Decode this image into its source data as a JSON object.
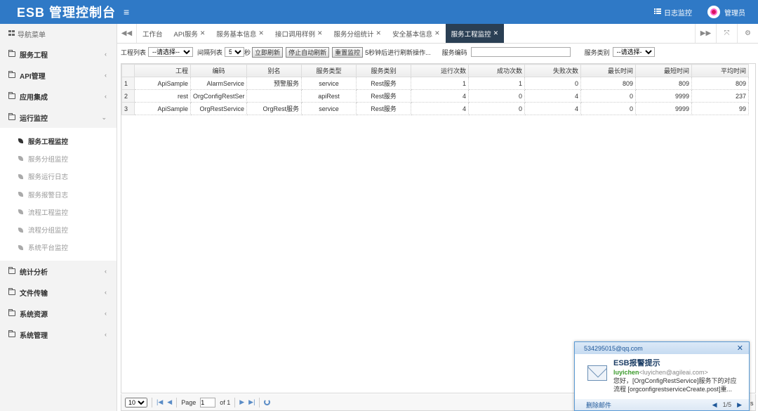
{
  "header": {
    "brand": "ESB 管理控制台",
    "menu_toggle": "≡",
    "log_monitor": "日志监控",
    "admin": "管理员"
  },
  "sidebar": {
    "nav_title": "导航菜单",
    "groups": [
      {
        "label": "服务工程",
        "chevron": "‹"
      },
      {
        "label": "API管理",
        "chevron": "‹"
      },
      {
        "label": "应用集成",
        "chevron": "‹"
      },
      {
        "label": "运行监控",
        "chevron": "⌄"
      }
    ],
    "sub_items": [
      {
        "label": "服务工程监控"
      },
      {
        "label": "服务分组监控"
      },
      {
        "label": "服务运行日志"
      },
      {
        "label": "服务报警日志"
      },
      {
        "label": "流程工程监控"
      },
      {
        "label": "流程分组监控"
      },
      {
        "label": "系统平台监控"
      }
    ],
    "groups_after": [
      {
        "label": "统计分析",
        "chevron": "‹"
      },
      {
        "label": "文件传输",
        "chevron": "‹"
      },
      {
        "label": "系统资源",
        "chevron": "‹"
      },
      {
        "label": "系统管理",
        "chevron": "‹"
      }
    ]
  },
  "tabs": {
    "prev": "◀◀",
    "items": [
      {
        "label": "工作台",
        "closable": ""
      },
      {
        "label": "API服务",
        "closable": "✕"
      },
      {
        "label": "服务基本信息",
        "closable": "✕"
      },
      {
        "label": "接口调用样例",
        "closable": "✕"
      },
      {
        "label": "服务分组统计",
        "closable": "✕"
      },
      {
        "label": "安全基本信息",
        "closable": "✕"
      },
      {
        "label": "服务工程监控",
        "closable": "✕"
      }
    ],
    "next": "▶▶",
    "fullscreen": "⤧",
    "settings": "⚙"
  },
  "toolbar": {
    "project_label": "工程列表",
    "project_select": "--请选择--",
    "interval_label": "间隔列表",
    "interval_value": "5",
    "seconds": "秒",
    "refresh_now": "立即刷新",
    "stop_auto": "停止自动刷新",
    "reset_monitor": "重置监控",
    "countdown": "5秒钟后进行刷新操作...",
    "service_code_label": "服务编码",
    "service_code_value": "",
    "service_category_label": "服务类别",
    "service_category_select": "--请选择--"
  },
  "grid": {
    "columns": [
      "",
      "工程",
      "编码",
      "别名",
      "服务类型",
      "服务类别",
      "运行次数",
      "成功次数",
      "失败次数",
      "最长时间",
      "最短时间",
      "平均时间"
    ],
    "rows": [
      {
        "rn": "1",
        "project": "ApiSample",
        "code": "AlarmService",
        "alias": "预警服务",
        "type": "service",
        "category": "Rest服务",
        "runs": "1",
        "success": "1",
        "fail": "0",
        "max": "809",
        "min": "809",
        "avg": "809"
      },
      {
        "rn": "2",
        "project": "rest",
        "code": "OrgConfigRestSer",
        "alias": "",
        "type": "apiRest",
        "category": "Rest服务",
        "runs": "4",
        "success": "0",
        "fail": "4",
        "max": "0",
        "min": "9999",
        "avg": "237"
      },
      {
        "rn": "3",
        "project": "ApiSample",
        "code": "OrgRestService",
        "alias": "OrgRest服务",
        "type": "service",
        "category": "Rest服务",
        "runs": "4",
        "success": "0",
        "fail": "4",
        "max": "0",
        "min": "9999",
        "avg": "99"
      }
    ]
  },
  "pager": {
    "page_size": "10",
    "page_label": "Page",
    "page_value": "1",
    "of_label": "of 1"
  },
  "notification": {
    "from": "534295015@qq.com",
    "title": "ESB报警提示",
    "sender": "luyichen",
    "sender_mail": "<luyichen@agileai.com>",
    "line1": "您好，[OrgConfigRestService]服务下的对应",
    "line2": "流程 [orgconfigrestserviceCreate.post]重...",
    "delete": "删除邮件",
    "page": "1/5"
  },
  "edge_text": "s"
}
